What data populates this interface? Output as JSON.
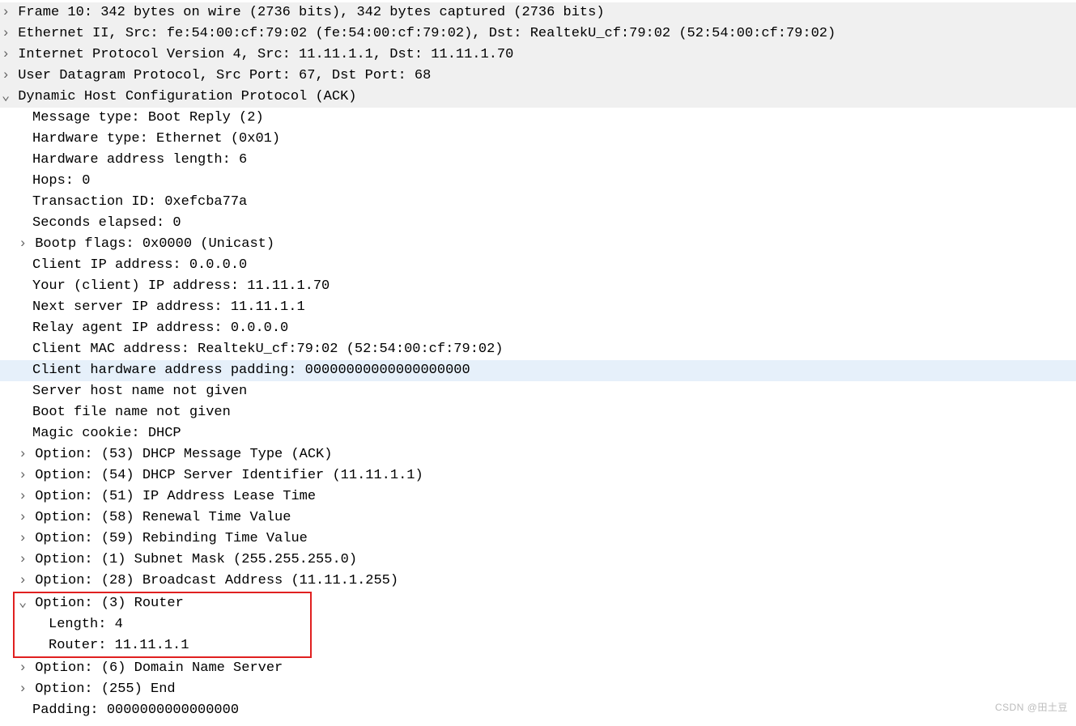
{
  "topBg": {
    "frame": "Frame 10: 342 bytes on wire (2736 bits), 342 bytes captured (2736 bits)",
    "eth": "Ethernet II, Src: fe:54:00:cf:79:02 (fe:54:00:cf:79:02), Dst: RealtekU_cf:79:02 (52:54:00:cf:79:02)",
    "ipv4": "Internet Protocol Version 4, Src: 11.11.1.1, Dst: 11.11.1.70",
    "udp": "User Datagram Protocol, Src Port: 67, Dst Port: 68",
    "dhcp": "Dynamic Host Configuration Protocol (ACK)"
  },
  "dhcp": {
    "msgType": "Message type: Boot Reply (2)",
    "hwType": "Hardware type: Ethernet (0x01)",
    "hwAddrLen": "Hardware address length: 6",
    "hops": "Hops: 0",
    "txnId": "Transaction ID: 0xefcba77a",
    "secElapsed": "Seconds elapsed: 0",
    "bootpFlags": "Bootp flags: 0x0000 (Unicast)",
    "clientIp": "Client IP address: 0.0.0.0",
    "yourIp": "Your (client) IP address: 11.11.1.70",
    "nextServer": "Next server IP address: 11.11.1.1",
    "relayAgent": "Relay agent IP address: 0.0.0.0",
    "clientMac": "Client MAC address: RealtekU_cf:79:02 (52:54:00:cf:79:02)",
    "clientHwPad": "Client hardware address padding: 00000000000000000000",
    "serverHost": "Server host name not given",
    "bootFile": "Boot file name not given",
    "magicCookie": "Magic cookie: DHCP"
  },
  "options": {
    "opt53": "Option: (53) DHCP Message Type (ACK)",
    "opt54": "Option: (54) DHCP Server Identifier (11.11.1.1)",
    "opt51": "Option: (51) IP Address Lease Time",
    "opt58": "Option: (58) Renewal Time Value",
    "opt59": "Option: (59) Rebinding Time Value",
    "opt1": "Option: (1) Subnet Mask (255.255.255.0)",
    "opt28": "Option: (28) Broadcast Address (11.11.1.255)",
    "opt3": {
      "header": "Option: (3) Router",
      "length": "Length: 4",
      "router": "Router: 11.11.1.1"
    },
    "opt6": "Option: (6) Domain Name Server",
    "opt255": "Option: (255) End",
    "padding": "Padding: 0000000000000000"
  },
  "watermark": "CSDN @田土豆"
}
